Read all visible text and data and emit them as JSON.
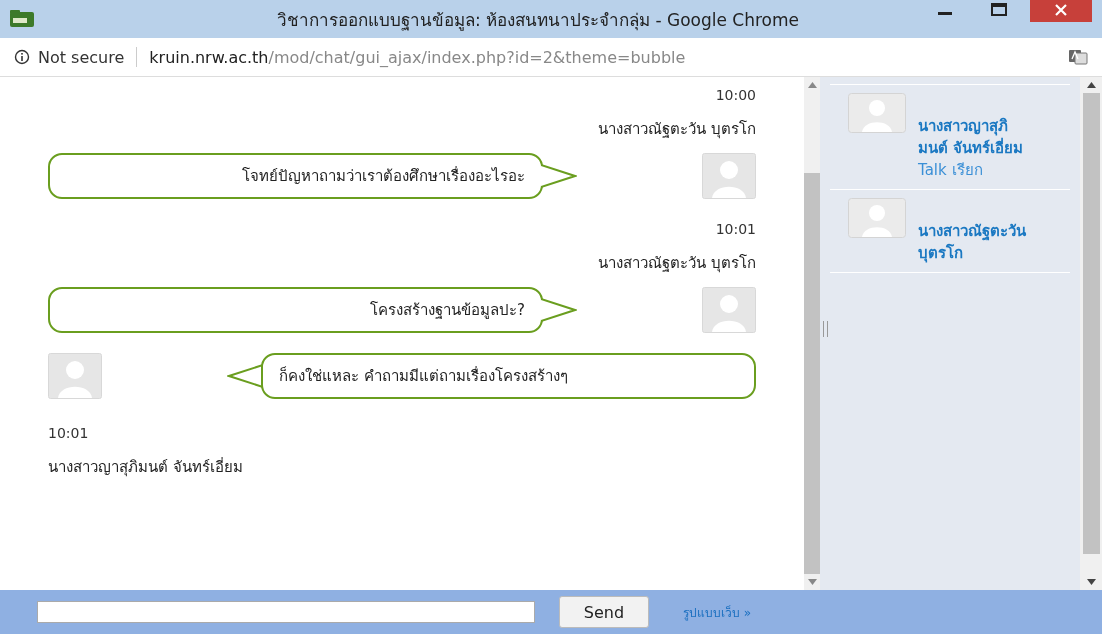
{
  "window": {
    "title": "วิชาการออกแบบฐานข้อมูล: ห้องสนทนาประจำกลุ่ม - Google Chrome"
  },
  "address_bar": {
    "security": "Not secure",
    "host": "kruin.nrw.ac.th",
    "path": "/mod/chat/gui_ajax/index.php?id=2&theme=bubble"
  },
  "messages": [
    {
      "kind": "right",
      "time": "10:00",
      "user": "นางสาวณัฐตะวัน บุตรโก",
      "text": "โจทย์ปัญหาถามว่าเราต้องศึกษาเรื่องอะไรอะ"
    },
    {
      "kind": "right",
      "time": "10:01",
      "user": "นางสาวณัฐตะวัน บุตรโก",
      "text": "โครงสร้างฐานข้อมูลปะ?"
    },
    {
      "kind": "left",
      "time": "10:01",
      "user": "นางสาวญาสุภิมนต์ จันทร์เอี่ยม",
      "text": "ก็คงใช่แหละ คำถามมีแต่ถามเรื่องโครงสร้างๆ"
    }
  ],
  "users": [
    {
      "name": "นางสาวญาสุภิมนต์ จันทร์เอี่ยม",
      "talk": "Talk",
      "beep": "เรียก"
    },
    {
      "name": "นางสาวณัฐตะวัน บุตรโก"
    }
  ],
  "send_button": "Send",
  "web_format_link": "รูปแบบเว็บ »"
}
